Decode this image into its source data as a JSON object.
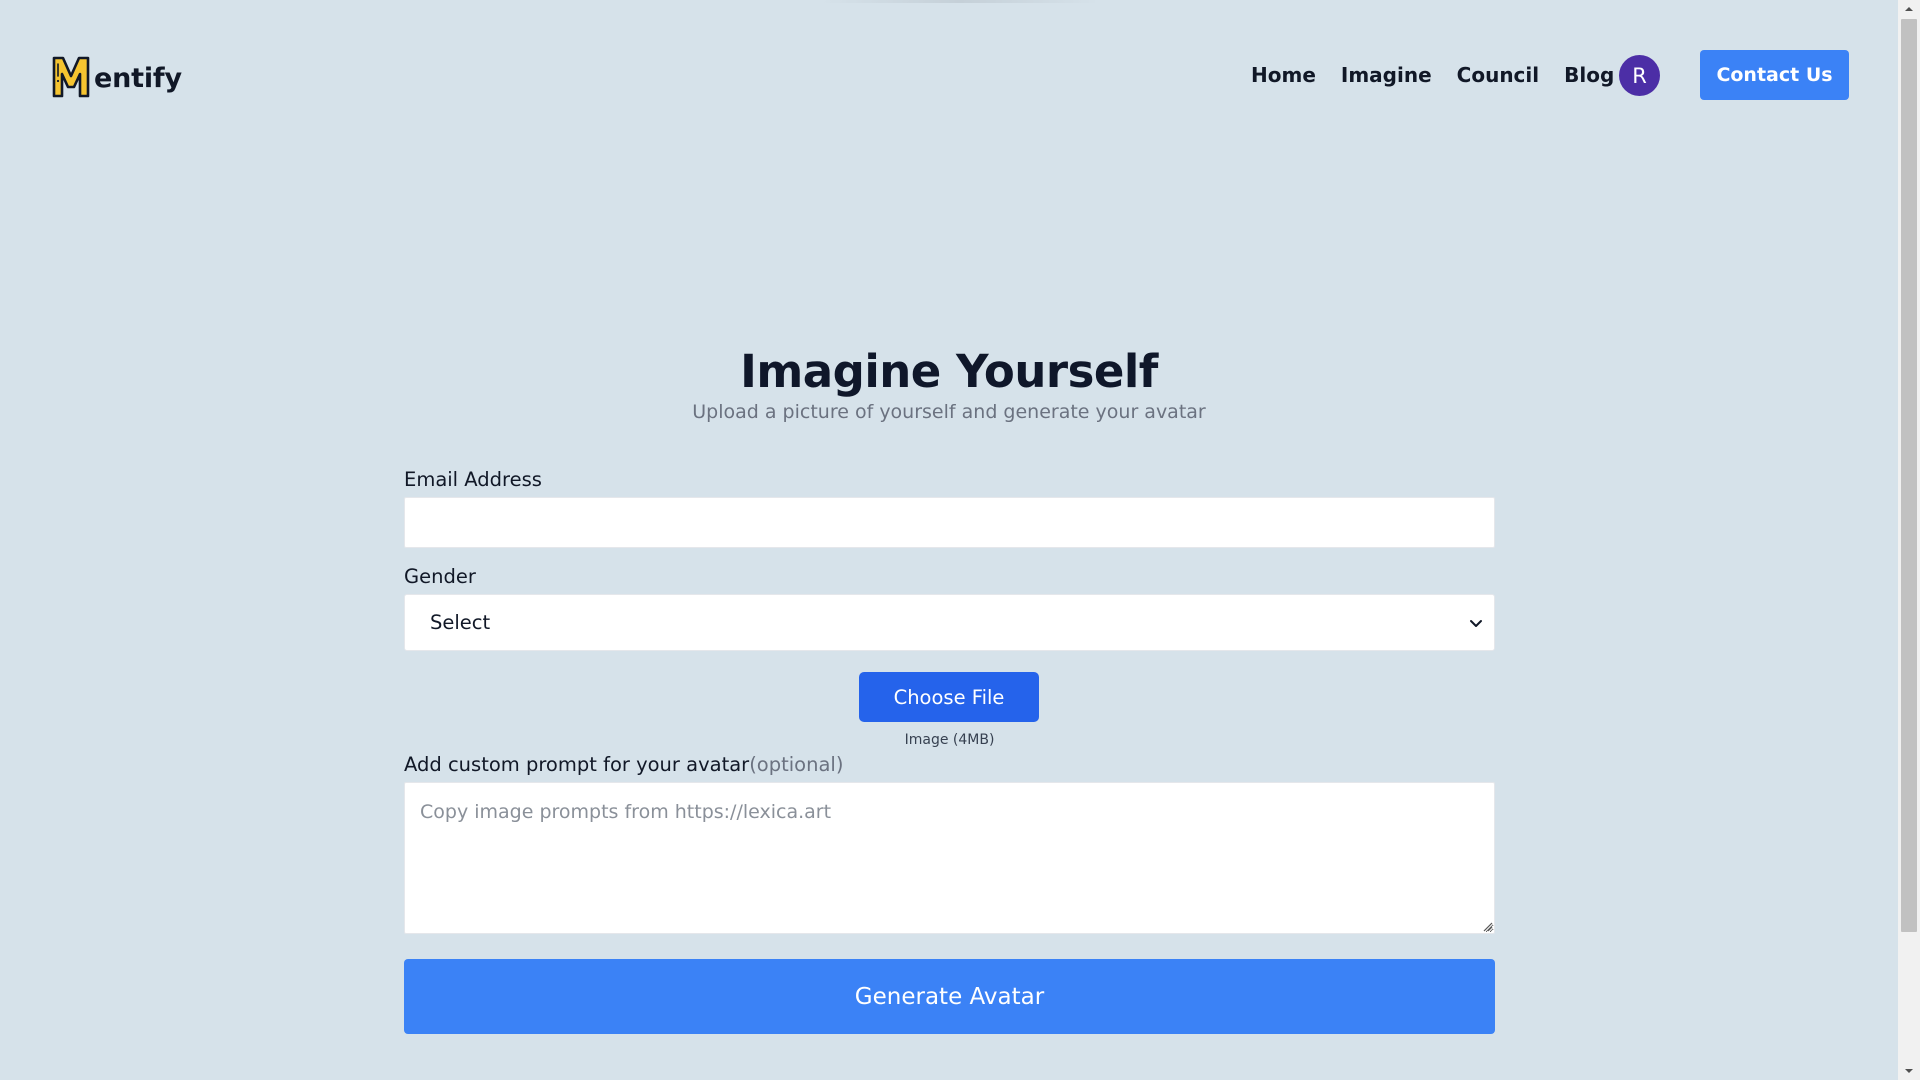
{
  "brand": {
    "name": "entify",
    "logo_letter": "M",
    "logo_color": "#f5c430"
  },
  "nav": {
    "links": [
      {
        "label": "Home"
      },
      {
        "label": "Imagine"
      },
      {
        "label": "Council"
      },
      {
        "label": "Blog"
      }
    ],
    "avatar_initial": "R",
    "avatar_color": "#4c2ea6",
    "contact_label": "Contact Us",
    "accent_color": "#3b82f6"
  },
  "main": {
    "title": "Imagine Yourself",
    "subtitle": "Upload a picture of yourself and generate your avatar",
    "email": {
      "label": "Email Address",
      "value": "",
      "placeholder": ""
    },
    "gender": {
      "label": "Gender",
      "selected": "Select"
    },
    "file": {
      "button_label": "Choose File",
      "hint": "Image (4MB)"
    },
    "prompt": {
      "label": "Add custom prompt for your avatar",
      "optional": "(optional)",
      "placeholder": "Copy image prompts from https://lexica.art",
      "value": ""
    },
    "generate_label": "Generate Avatar"
  }
}
